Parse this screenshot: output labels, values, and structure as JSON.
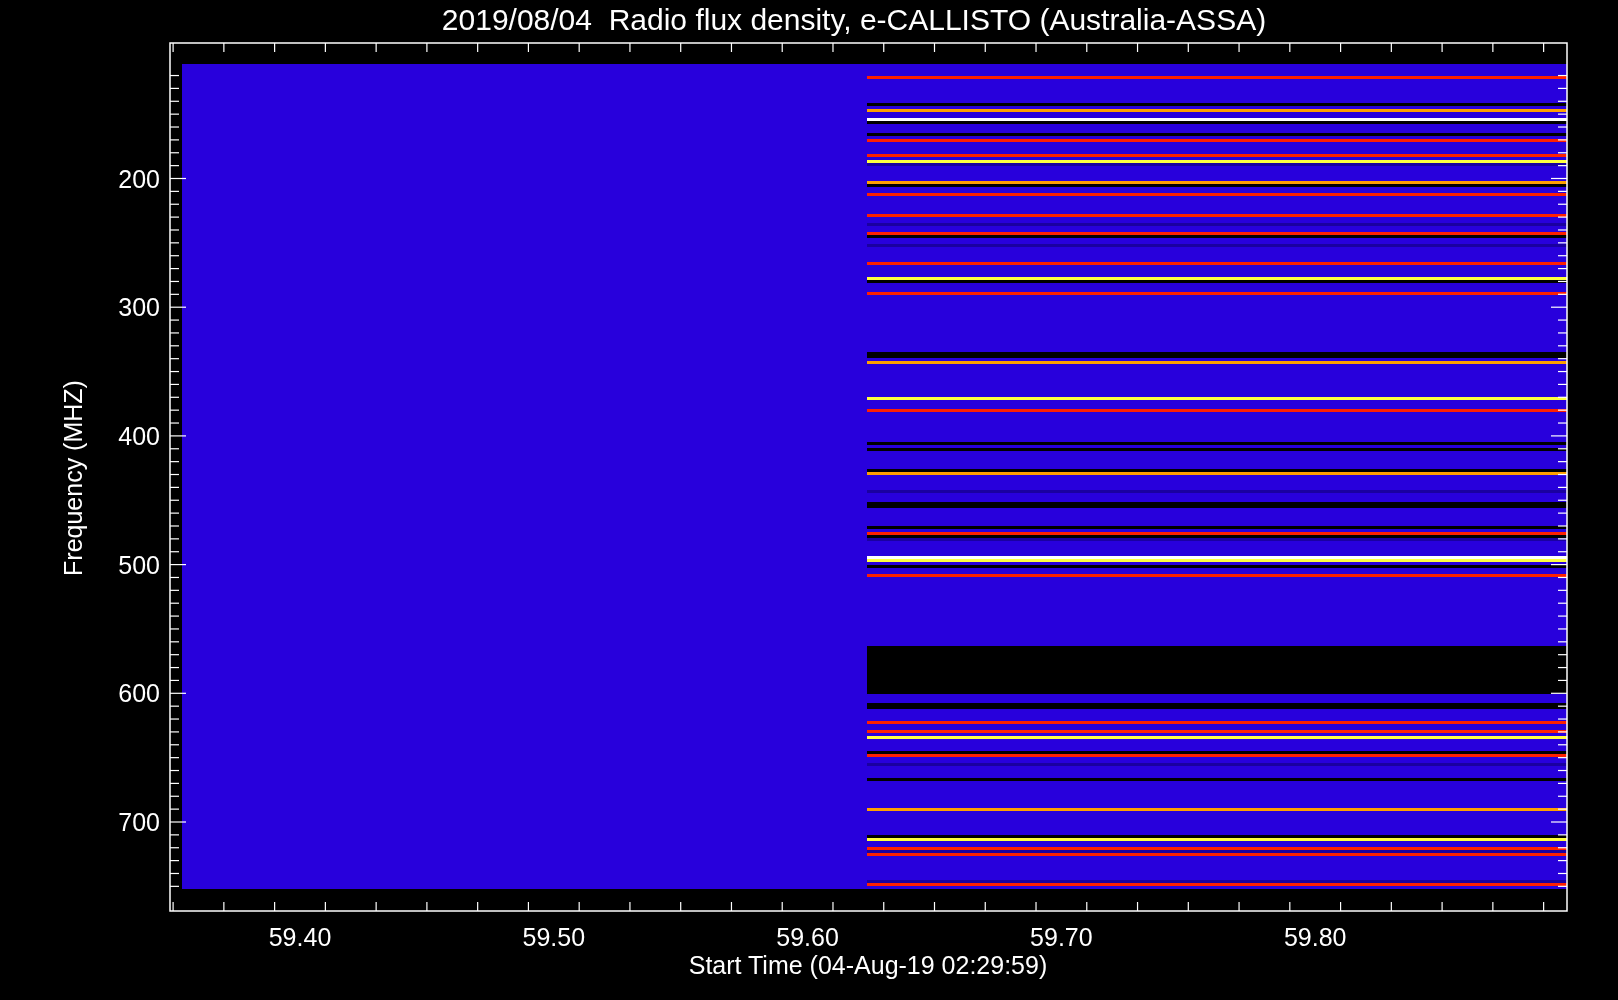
{
  "title": "2019/08/04  Radio flux density, e-CALLISTO (Australia-ASSA)",
  "plot": {
    "ylabel": "Frequency (MHZ)",
    "xlabel": "Start Time (04-Aug-19 02:29:59)",
    "yticks": [
      "200",
      "300",
      "400",
      "500",
      "600",
      "700"
    ],
    "xticks": [
      "59.40",
      "59.50",
      "59.60",
      "59.70",
      "59.80"
    ]
  }
}
